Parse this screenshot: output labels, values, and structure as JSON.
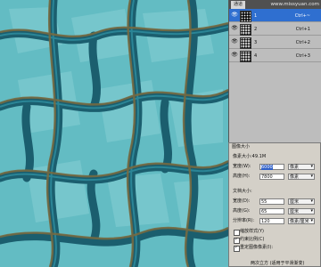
{
  "channels_panel": {
    "tab_label": "通道",
    "watermark": "www.missyuan.com",
    "channels": [
      {
        "name": "1",
        "shortcut": "Ctrl+~",
        "selected": true
      },
      {
        "name": "2",
        "shortcut": "Ctrl+1",
        "selected": false
      },
      {
        "name": "3",
        "shortcut": "Ctrl+2",
        "selected": false
      },
      {
        "name": "4",
        "shortcut": "Ctrl+3",
        "selected": false
      }
    ]
  },
  "image_size_dialog": {
    "title": "图像大小",
    "pixel_dimensions_label": "像素大小:49.1M",
    "width_label": "宽度(W):",
    "width_value": "6000",
    "width_unit": "像素",
    "height_label": "高度(H):",
    "height_value": "7800",
    "height_unit": "像素",
    "document_size_label": "文档大小:",
    "doc_width_label": "宽度(D):",
    "doc_width_value": "55",
    "doc_width_unit": "厘米",
    "doc_height_label": "高度(G):",
    "doc_height_value": "65",
    "doc_height_unit": "厘米",
    "resolution_label": "分辨率(R):",
    "resolution_value": "120",
    "resolution_unit": "像素/厘米",
    "scale_styles_label": "缩放样式(Y)",
    "constrain_label": "约束比例(C)",
    "resample_label": "重定图像像素(I):",
    "footer_text": "两次立方 (适用于平滑渐变)"
  }
}
